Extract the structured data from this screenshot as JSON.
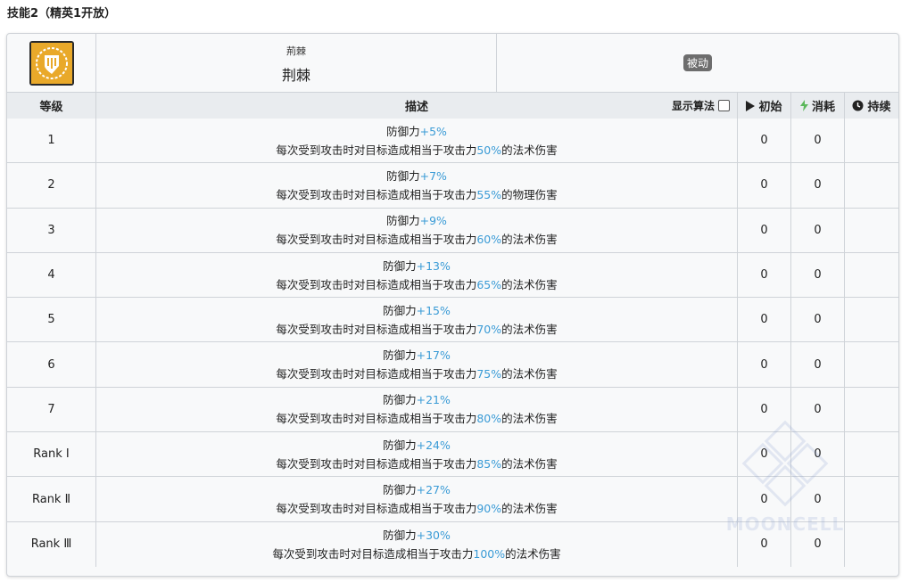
{
  "section_title": "技能2（精英1开放）",
  "skill": {
    "name_ruby": "荊棘",
    "name": "荆棘",
    "type_badge": "被动",
    "icon": "thorns-shield-icon"
  },
  "columns": {
    "level": "等级",
    "description": "描述",
    "show_algorithm": "显示算法",
    "initial": "初始",
    "cost": "消耗",
    "duration": "持续"
  },
  "colors": {
    "highlight": "#3a9bd6",
    "header_bg": "#e9ecef",
    "badge_bg": "#6d6d6d",
    "cost_icon": "#5cb85c"
  },
  "rows": [
    {
      "level": "1",
      "line1_prefix": "防御力",
      "def": "+5%",
      "line2_prefix": "每次受到攻击时对目标造成相当于攻击力",
      "atk": "50%",
      "line2_suffix": "的法术伤害",
      "initial": "0",
      "cost": "0",
      "duration": ""
    },
    {
      "level": "2",
      "line1_prefix": "防御力",
      "def": "+7%",
      "line2_prefix": "每次受到攻击时对目标造成相当于攻击力",
      "atk": "55%",
      "line2_suffix": "的物理伤害",
      "initial": "0",
      "cost": "0",
      "duration": ""
    },
    {
      "level": "3",
      "line1_prefix": "防御力",
      "def": "+9%",
      "line2_prefix": "每次受到攻击时对目标造成相当于攻击力",
      "atk": "60%",
      "line2_suffix": "的法术伤害",
      "initial": "0",
      "cost": "0",
      "duration": ""
    },
    {
      "level": "4",
      "line1_prefix": "防御力",
      "def": "+13%",
      "line2_prefix": "每次受到攻击时对目标造成相当于攻击力",
      "atk": "65%",
      "line2_suffix": "的法术伤害",
      "initial": "0",
      "cost": "0",
      "duration": ""
    },
    {
      "level": "5",
      "line1_prefix": "防御力",
      "def": "+15%",
      "line2_prefix": "每次受到攻击时对目标造成相当于攻击力",
      "atk": "70%",
      "line2_suffix": "的法术伤害",
      "initial": "0",
      "cost": "0",
      "duration": ""
    },
    {
      "level": "6",
      "line1_prefix": "防御力",
      "def": "+17%",
      "line2_prefix": "每次受到攻击时对目标造成相当于攻击力",
      "atk": "75%",
      "line2_suffix": "的法术伤害",
      "initial": "0",
      "cost": "0",
      "duration": ""
    },
    {
      "level": "7",
      "line1_prefix": "防御力",
      "def": "+21%",
      "line2_prefix": "每次受到攻击时对目标造成相当于攻击力",
      "atk": "80%",
      "line2_suffix": "的法术伤害",
      "initial": "0",
      "cost": "0",
      "duration": ""
    },
    {
      "level": "Rank Ⅰ",
      "line1_prefix": "防御力",
      "def": "+24%",
      "line2_prefix": "每次受到攻击时对目标造成相当于攻击力",
      "atk": "85%",
      "line2_suffix": "的法术伤害",
      "initial": "0",
      "cost": "0",
      "duration": ""
    },
    {
      "level": "Rank Ⅱ",
      "line1_prefix": "防御力",
      "def": "+27%",
      "line2_prefix": "每次受到攻击时对目标造成相当于攻击力",
      "atk": "90%",
      "line2_suffix": "的法术伤害",
      "initial": "0",
      "cost": "0",
      "duration": ""
    },
    {
      "level": "Rank Ⅲ",
      "line1_prefix": "防御力",
      "def": "+30%",
      "line2_prefix": "每次受到攻击时对目标造成相当于攻击力",
      "atk": "100%",
      "line2_suffix": "的法术伤害",
      "initial": "0",
      "cost": "0",
      "duration": ""
    }
  ],
  "watermark": "MOONCELL"
}
